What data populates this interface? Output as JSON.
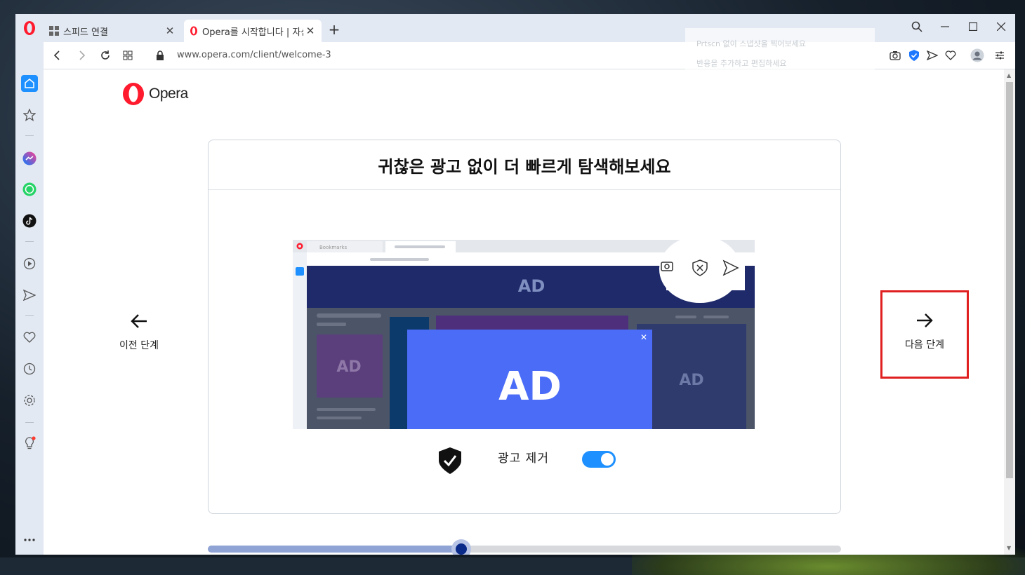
{
  "tabs": [
    {
      "label": "스피드 연결",
      "icon": "speed-dial-icon",
      "active": false
    },
    {
      "label": "Opera를 시작합니다 | 자신",
      "icon": "opera-logo-icon",
      "active": true
    }
  ],
  "address": {
    "url": "www.opera.com/client/welcome-3"
  },
  "ghost_tooltip": {
    "line1": "Prtscn 없이 스냅샷을 찍어보세요",
    "line2": "반응을 추가하고 편집하세요"
  },
  "brand": {
    "logo_text": "Opera",
    "accent": "#ff1b2d"
  },
  "card": {
    "title": "귀찮은 광고 없이 더 빠르게 탐색해보세요",
    "toggle_label": "광고 제거",
    "toggle_on": true
  },
  "illustration": {
    "tab_label": "Bookmarks",
    "ad_text": "AD"
  },
  "nav": {
    "prev_label": "이전 단계",
    "next_label": "다음 단계"
  },
  "progress": {
    "value": 0.4
  },
  "colors": {
    "toggle": "#1e90ff",
    "highlight_box": "#e02020",
    "ad_blue": "#4a6cf7",
    "ad_navy": "#1f2a6b"
  }
}
